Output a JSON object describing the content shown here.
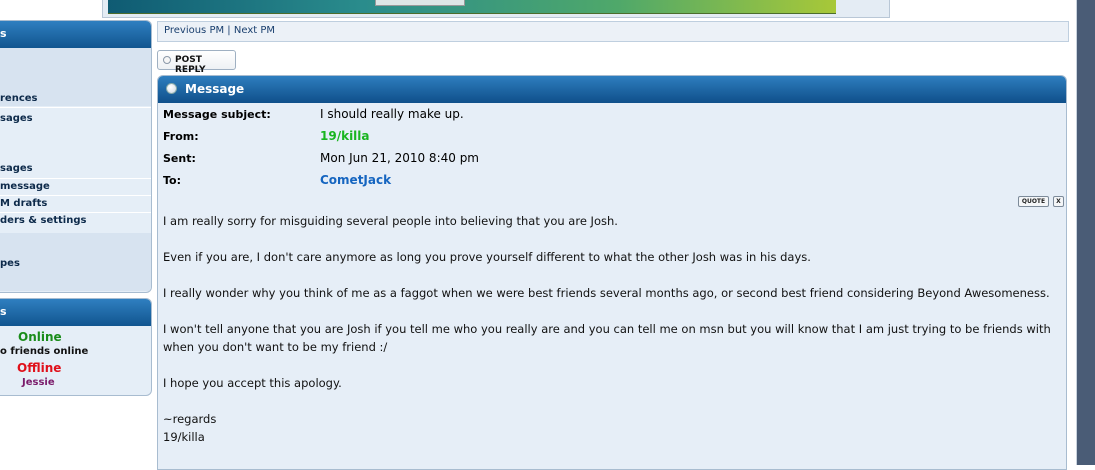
{
  "sidebar": {
    "nav_items": [
      "rences",
      "sages",
      "sages",
      "message",
      "M drafts",
      "ders & settings",
      "pes"
    ],
    "friends": {
      "online_label": "Online",
      "no_friends_text": "o friends online",
      "offline_label": "Offline",
      "offline_friend": "Jessie"
    },
    "header_fragment_1": "s",
    "header_fragment_2": "s"
  },
  "nav": {
    "previous": "Previous PM",
    "separator": "|",
    "next": "Next PM"
  },
  "post_reply_label": "POST REPLY",
  "message": {
    "panel_title": "Message",
    "subject_label": "Message subject:",
    "subject": "I should really make up.",
    "from_label": "From:",
    "from": "19/killa",
    "sent_label": "Sent:",
    "sent": "Mon Jun 21, 2010 8:40 pm",
    "to_label": "To:",
    "to": "CometJack",
    "quote_label": "QUOTE",
    "close_label": "X",
    "body": [
      "I am really sorry for misguiding several people into believing that you are Josh.",
      "Even if you are, I don't care anymore as long you prove yourself different to what the other Josh was in his days.",
      "I really wonder why you think of me as a faggot when we were best friends several months ago, or second best friend considering Beyond Awesomeness.",
      "I won't tell anyone that you are Josh if you tell me who you really are and you can tell me on msn but you will know that I am just trying to be friends with when you don't want to be my friend :/",
      "I hope you accept this apology."
    ],
    "signature_line1": "~regards",
    "signature_line2": "19/killa"
  },
  "colors": {
    "header_blue": "#11558f",
    "online_green": "#1a8c1a",
    "offline_red": "#e0101a",
    "from_green": "#19b51f",
    "to_blue": "#1565c0",
    "friend_purple": "#7a1a6a"
  }
}
